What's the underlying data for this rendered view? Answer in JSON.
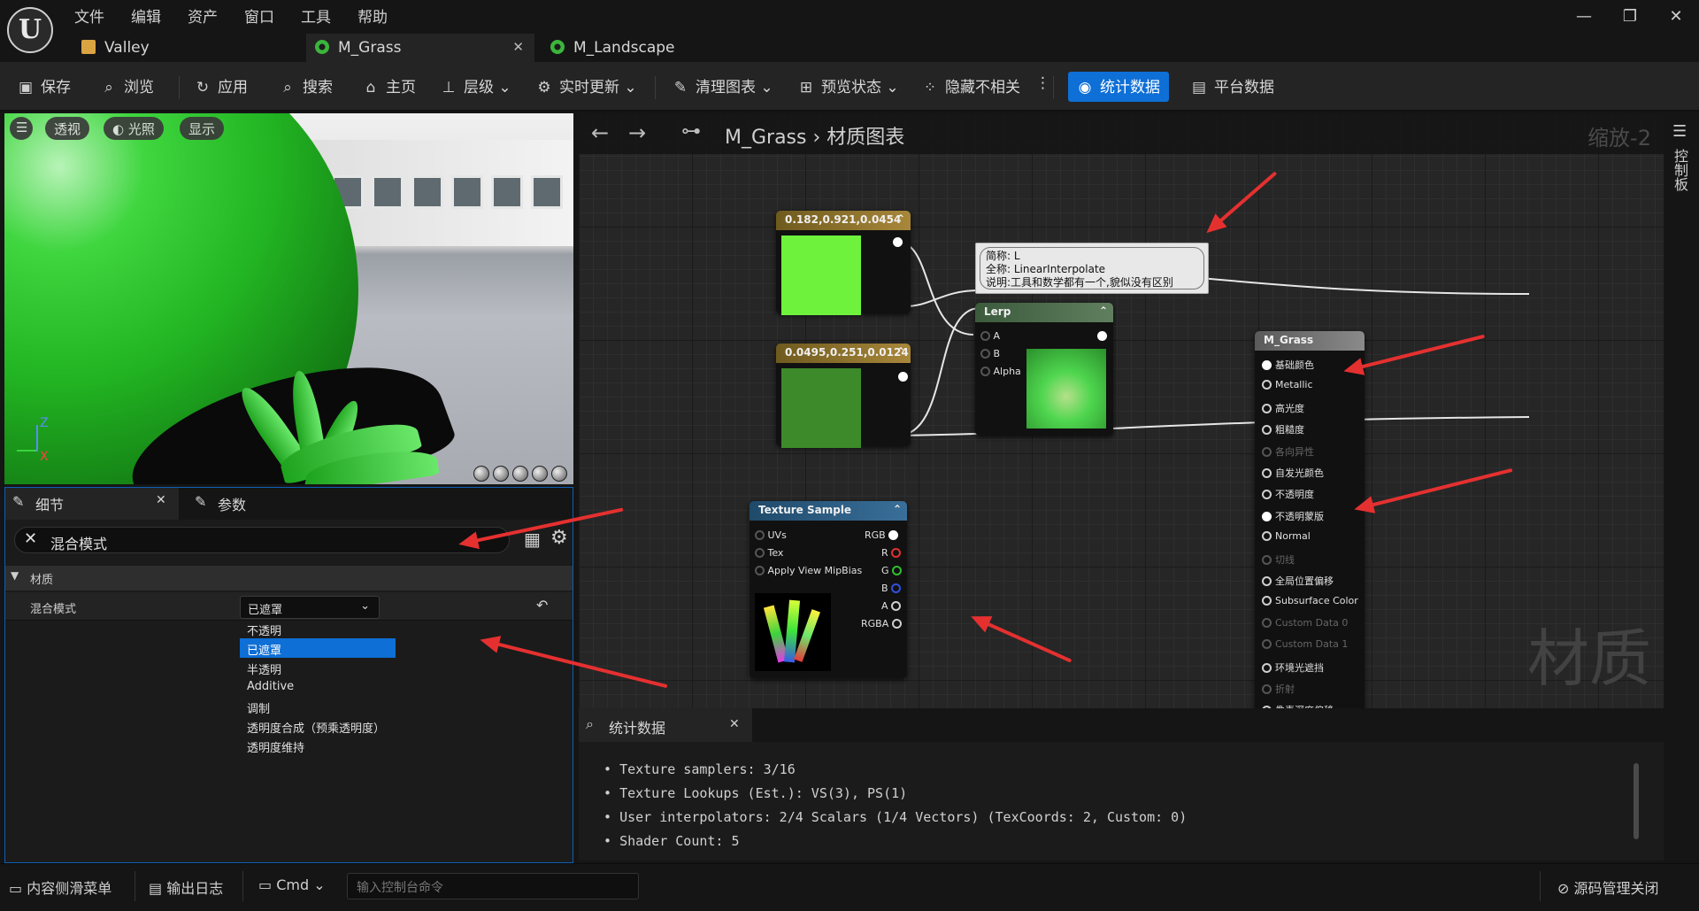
{
  "menu": [
    "文件",
    "编辑",
    "资产",
    "窗口",
    "工具",
    "帮助"
  ],
  "logo_text": "U",
  "window_controls": [
    "—",
    "❐",
    "✕"
  ],
  "tabs": [
    {
      "label": "Valley",
      "icon": "level-icon",
      "color": "#d9a441"
    },
    {
      "label": "M_Grass",
      "icon": "material-icon",
      "color": "#3bb53b",
      "close": "✕"
    },
    {
      "label": "M_Landscape",
      "icon": "material-icon",
      "color": "#3bb53b"
    }
  ],
  "toolbar": {
    "save": "保存",
    "browse": "浏览",
    "apply": "应用",
    "search": "搜索",
    "home": "主页",
    "hierarchy": "层级",
    "live_update": "实时更新",
    "clean_graph": "清理图表",
    "preview_state": "预览状态",
    "hide_unrelated": "隐藏不相关",
    "more": "⋮",
    "stats": "统计数据",
    "platform_stats": "平台数据",
    "accent": "#0e6fd6"
  },
  "viewport": {
    "menu": "☰",
    "perspective": "透视",
    "lit": "光照",
    "show": "显示",
    "axis_z": "Z",
    "axis_x": "X"
  },
  "details": {
    "tab_details": "细节",
    "tab_params": "参数",
    "close": "✕",
    "search_value": "混合模式",
    "category": "材质",
    "property_label": "混合模式",
    "selected_value": "已遮罩",
    "options": [
      "不透明",
      "已遮罩",
      "半透明",
      "Additive",
      "调制",
      "透明度合成（预乘透明度）",
      "透明度维持"
    ],
    "selected_index": 1
  },
  "graph": {
    "back": "←",
    "forward": "→",
    "asset": "M_Grass",
    "sep": "›",
    "graph_name": "材质图表",
    "zoom": "缩放-2",
    "watermark": "材质",
    "right_rail": "控制板",
    "const1": {
      "title": "0.182,0.921,0.0454",
      "color": "#6ef23c"
    },
    "const2": {
      "title": "0.0495,0.251,0.0124",
      "color": "#3d8a2a"
    },
    "tooltip": {
      "line1": "简称: L",
      "line2": "全称: LinearInterpolate",
      "line3": "说明:工具和数学都有一个,貌似没有区别"
    },
    "lerp": {
      "title": "Lerp",
      "pins": [
        "A",
        "B",
        "Alpha"
      ]
    },
    "texture": {
      "title": "Texture Sample",
      "inputs": [
        "UVs",
        "Tex",
        "Apply View MipBias"
      ],
      "outputs": [
        "RGB",
        "R",
        "G",
        "B",
        "A",
        "RGBA"
      ]
    },
    "result": {
      "title": "M_Grass",
      "pins": [
        {
          "label": "基础颜色",
          "state": "connected"
        },
        {
          "label": "Metallic",
          "state": "enabled"
        },
        {
          "label": "高光度",
          "state": "enabled"
        },
        {
          "label": "粗糙度",
          "state": "enabled"
        },
        {
          "label": "各向异性",
          "state": "disabled"
        },
        {
          "label": "自发光颜色",
          "state": "enabled"
        },
        {
          "label": "不透明度",
          "state": "enabled"
        },
        {
          "label": "不透明蒙版",
          "state": "connected"
        },
        {
          "label": "Normal",
          "state": "enabled"
        },
        {
          "label": "切线",
          "state": "disabled"
        },
        {
          "label": "全局位置偏移",
          "state": "enabled"
        },
        {
          "label": "Subsurface Color",
          "state": "enabled"
        },
        {
          "label": "Custom Data 0",
          "state": "disabled"
        },
        {
          "label": "Custom Data 1",
          "state": "disabled"
        },
        {
          "label": "环境光遮挡",
          "state": "enabled"
        },
        {
          "label": "折射",
          "state": "disabled"
        },
        {
          "label": "像素深度偏移",
          "state": "enabled"
        }
      ]
    }
  },
  "stats": {
    "tab": "统计数据",
    "close": "✕",
    "lines": [
      "Texture samplers: 3/16",
      "Texture Lookups (Est.): VS(3), PS(1)",
      "User interpolators: 2/4 Scalars (1/4 Vectors) (TexCoords: 2, Custom: 0)",
      "Shader Count: 5"
    ]
  },
  "statusbar": {
    "content_drawer": "内容侧滑菜单",
    "output_log": "输出日志",
    "cmd": "Cmd",
    "cmd_placeholder": "输入控制台命令",
    "source_control": "源码管理关闭"
  }
}
